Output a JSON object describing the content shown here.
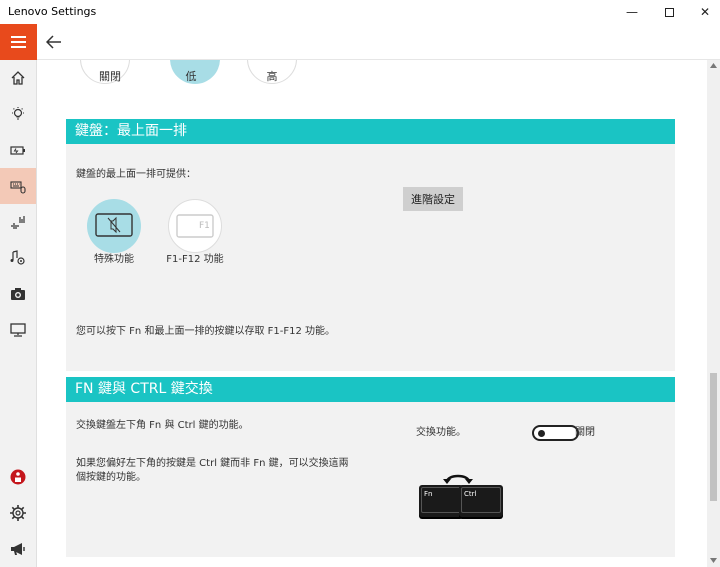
{
  "window": {
    "title": "Lenovo Settings",
    "min_glyph": "—",
    "close_glyph": "✕"
  },
  "brightness": {
    "options": [
      "關閉",
      "低",
      "高"
    ]
  },
  "top_row": {
    "header": "鍵盤：最上面一排",
    "intro": "鍵盤的最上面一排可提供：",
    "advanced_button": "進階設定",
    "options": [
      "特殊功能",
      "F1-F12 功能"
    ],
    "f1_key": "F1",
    "note": "您可以按下 Fn 和最上面一排的按鍵以存取 F1-F12 功能。"
  },
  "fn_ctrl": {
    "header": "FN 鍵與 CTRL 鍵交換",
    "desc1": "交換鍵盤左下角 Fn 與 Ctrl 鍵的功能。",
    "desc2_line1": "如果您偏好左下角的按鍵是 Ctrl 鍵而非 Fn 鍵，可以交換這兩",
    "desc2_line2": "個按鍵的功能。",
    "swap_label": "交換功能。",
    "toggle_state": "關閉",
    "toggle_on": false,
    "key_fn": "Fn",
    "key_ctrl": "Ctrl"
  },
  "colors": {
    "accent": "#1ac4c4",
    "brand": "#e84a1c",
    "selected_circle": "#a8dde6"
  }
}
